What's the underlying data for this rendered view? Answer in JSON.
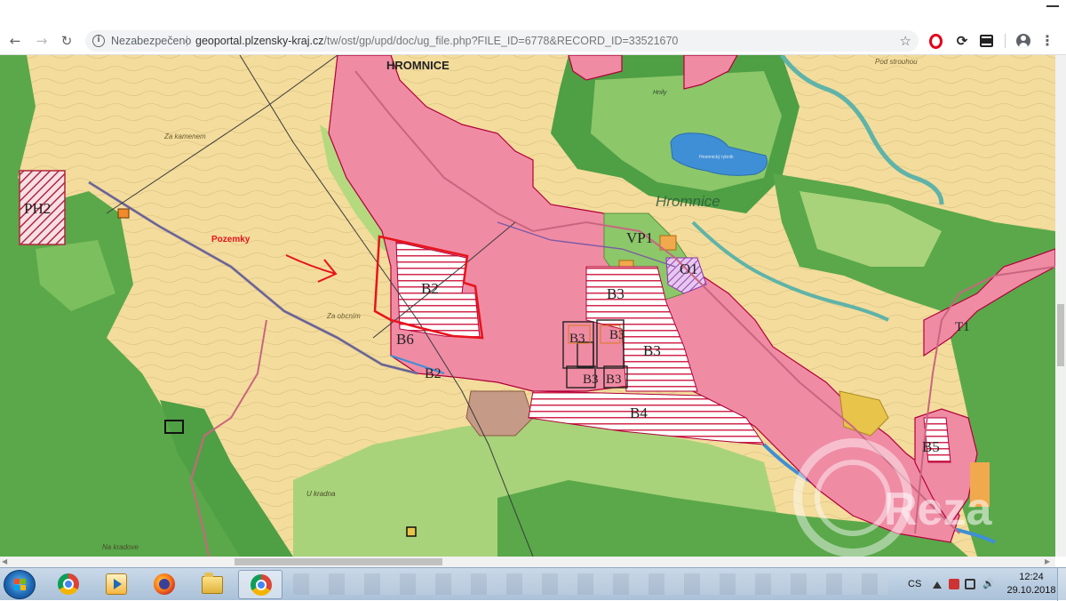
{
  "browser": {
    "security_label": "Nezabezpečeno",
    "url_host": "geoportal.plzensky-kraj.cz",
    "url_path": "/tw/ost/gp/upd/doc/ug_file.php?FILE_ID=6778&RECORD_ID=33521670",
    "icons": [
      "back-icon",
      "forward-icon",
      "reload-icon",
      "info-icon",
      "star-icon",
      "opera-icon",
      "sync-icon",
      "extension-icon",
      "profile-icon",
      "menu-icon"
    ]
  },
  "map": {
    "labels": {
      "village": "HROMNICE",
      "area_hromnice": "Hromnice",
      "za_kamenem": "Za kamenem",
      "pozemky": "Pozemky",
      "za_obcnikem": "Za obcním",
      "u_kradna": "U kradna",
      "na_kradove": "Na kradove",
      "pod_strouhou": "Pod strouhou",
      "hnily": "Hnily",
      "rybnik": "Hromnický rybník"
    },
    "zones": {
      "ph2": "PH2",
      "b2": "B2",
      "b2_small": "B2",
      "b3_main": "B3",
      "b3_a": "B3",
      "b3_b": "B3",
      "b3_c": "B3",
      "b3_d": "B3",
      "b3_e": "B3",
      "b4": "B4",
      "b5": "B5",
      "b6": "B6",
      "vp1": "VP1",
      "o1": "O1",
      "t1": "T1"
    },
    "colors": {
      "built_up": "#f08ba4",
      "built_up_edge": "#b0003a",
      "agricultural": "#f3dc9c",
      "forest": "#5aa84a",
      "meadow": "#a8d37a",
      "water": "#3f8fd6",
      "highlight": "#e8131b"
    }
  },
  "watermark": "Reza",
  "taskbar": {
    "language": "CS",
    "time": "12:24",
    "date": "29.10.2018",
    "apps": [
      "chrome-icon",
      "media-player-icon",
      "firefox-icon",
      "explorer-icon",
      "chrome-icon"
    ]
  }
}
